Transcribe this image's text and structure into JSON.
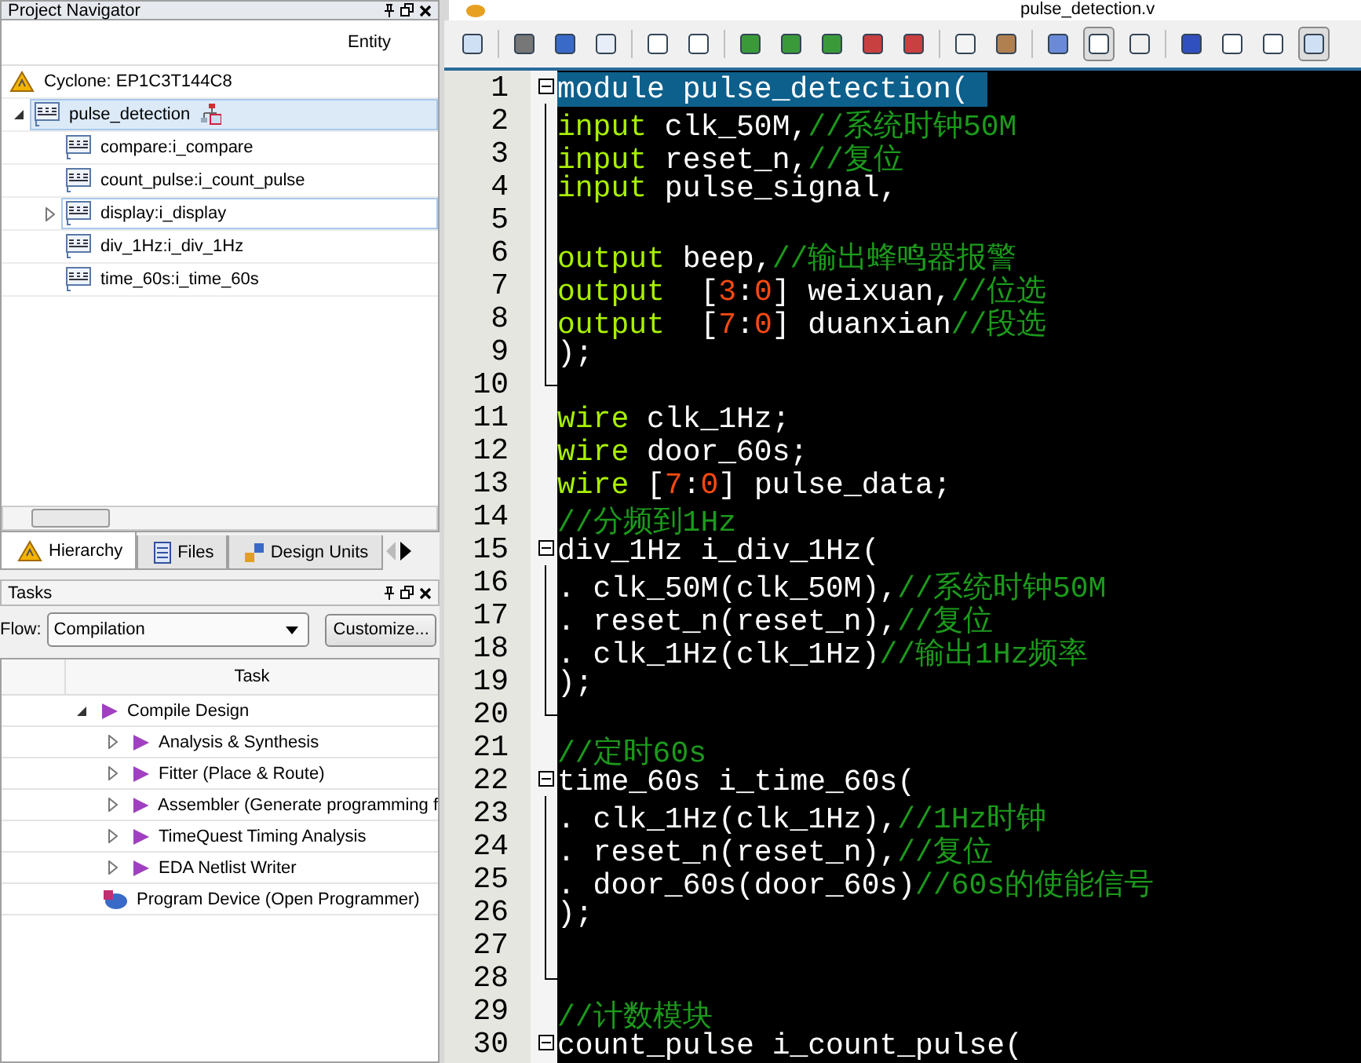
{
  "navigator": {
    "title": "Project Navigator",
    "column": "Entity",
    "device": {
      "label": "Cyclone: EP1C3T144C8"
    },
    "tree": [
      {
        "label": "pulse_detection",
        "selected": true,
        "expanded": true,
        "children": [
          {
            "label": "compare:i_compare",
            "selected": false
          },
          {
            "label": "count_pulse:i_count_pulse",
            "selected": false
          },
          {
            "label": "display:i_display",
            "selected": false,
            "hovered": true,
            "expanded": false
          },
          {
            "label": "div_1Hz:i_div_1Hz",
            "selected": false
          },
          {
            "label": "time_60s:i_time_60s",
            "selected": false
          }
        ]
      }
    ],
    "tabs": [
      {
        "label": "Hierarchy",
        "selected": true
      },
      {
        "label": "Files",
        "selected": false
      },
      {
        "label": "Design Units",
        "selected": false
      }
    ]
  },
  "tasks": {
    "title": "Tasks",
    "flow_label": "Flow:",
    "flow_value": "Compilation",
    "customize": "Customize...",
    "column": "Task",
    "items": [
      {
        "label": "Compile Design",
        "kind": "play",
        "expanded": true,
        "children": [
          {
            "label": "Analysis & Synthesis",
            "kind": "play",
            "expanded": false
          },
          {
            "label": "Fitter (Place & Route)",
            "kind": "play",
            "expanded": false
          },
          {
            "label": "Assembler (Generate programming f",
            "kind": "play",
            "expanded": false
          },
          {
            "label": "TimeQuest Timing Analysis",
            "kind": "play",
            "expanded": false
          },
          {
            "label": "EDA Netlist Writer",
            "kind": "play",
            "expanded": false
          }
        ]
      },
      {
        "label": "Program Device (Open Programmer)",
        "kind": "program"
      }
    ]
  },
  "editor": {
    "file_title": "pulse_detection.v",
    "lines": [
      {
        "no": "1",
        "kind": "fold_start",
        "selected": true,
        "parts": [
          {
            "kind": "plain",
            "text": "module pulse_detection( "
          }
        ]
      },
      {
        "no": "2",
        "kind": "fold_body",
        "parts": [
          {
            "kind": "kw",
            "text": "input"
          },
          {
            "kind": "plain",
            "text": " clk_50M,"
          },
          {
            "kind": "cm",
            "text": "//系统时钟50M"
          }
        ]
      },
      {
        "no": "3",
        "kind": "fold_body",
        "parts": [
          {
            "kind": "kw",
            "text": "input"
          },
          {
            "kind": "plain",
            "text": " reset_n,"
          },
          {
            "kind": "cm",
            "text": "//复位"
          }
        ]
      },
      {
        "no": "4",
        "kind": "fold_body",
        "parts": [
          {
            "kind": "kw",
            "text": "input"
          },
          {
            "kind": "plain",
            "text": " pulse_signal,"
          }
        ]
      },
      {
        "no": "5",
        "kind": "fold_body"
      },
      {
        "no": "6",
        "kind": "fold_body",
        "parts": [
          {
            "kind": "kw",
            "text": "output"
          },
          {
            "kind": "plain",
            "text": " beep,"
          },
          {
            "kind": "cm",
            "text": "//输出蜂鸣器报警"
          }
        ]
      },
      {
        "no": "7",
        "kind": "fold_body",
        "parts": [
          {
            "kind": "kw",
            "text": "output"
          },
          {
            "kind": "plain",
            "text": "  ["
          },
          {
            "kind": "num",
            "text": "3"
          },
          {
            "kind": "plain",
            "text": ":"
          },
          {
            "kind": "num",
            "text": "0"
          },
          {
            "kind": "plain",
            "text": "] weixuan,"
          },
          {
            "kind": "cm",
            "text": "//位选"
          }
        ]
      },
      {
        "no": "8",
        "kind": "fold_body",
        "parts": [
          {
            "kind": "kw",
            "text": "output"
          },
          {
            "kind": "plain",
            "text": "  ["
          },
          {
            "kind": "num",
            "text": "7"
          },
          {
            "kind": "plain",
            "text": ":"
          },
          {
            "kind": "num",
            "text": "0"
          },
          {
            "kind": "plain",
            "text": "] duanxian"
          },
          {
            "kind": "cm",
            "text": "//段选"
          }
        ]
      },
      {
        "no": "9",
        "kind": "fold_body",
        "parts": [
          {
            "kind": "plain",
            "text": ");"
          }
        ]
      },
      {
        "no": "10",
        "kind": "fold_end"
      },
      {
        "no": "11",
        "kind": "plain",
        "parts": [
          {
            "kind": "kw",
            "text": "wire"
          },
          {
            "kind": "plain",
            "text": " clk_1Hz;"
          }
        ]
      },
      {
        "no": "12",
        "kind": "plain",
        "parts": [
          {
            "kind": "kw",
            "text": "wire"
          },
          {
            "kind": "plain",
            "text": " door_60s;"
          }
        ]
      },
      {
        "no": "13",
        "kind": "plain",
        "parts": [
          {
            "kind": "kw",
            "text": "wire"
          },
          {
            "kind": "plain",
            "text": " ["
          },
          {
            "kind": "num",
            "text": "7"
          },
          {
            "kind": "plain",
            "text": ":"
          },
          {
            "kind": "num",
            "text": "0"
          },
          {
            "kind": "plain",
            "text": "] pulse_data;"
          }
        ]
      },
      {
        "no": "14",
        "kind": "plain",
        "parts": [
          {
            "kind": "cm",
            "text": "//分频到1Hz"
          }
        ]
      },
      {
        "no": "15",
        "kind": "fold_start",
        "parts": [
          {
            "kind": "plain",
            "text": "div_1Hz i_div_1Hz("
          }
        ]
      },
      {
        "no": "16",
        "kind": "fold_body",
        "parts": [
          {
            "kind": "plain",
            "text": ". clk_50M(clk_50M),"
          },
          {
            "kind": "cm",
            "text": "//系统时钟50M"
          }
        ]
      },
      {
        "no": "17",
        "kind": "fold_body",
        "parts": [
          {
            "kind": "plain",
            "text": ". reset_n(reset_n),"
          },
          {
            "kind": "cm",
            "text": "//复位"
          }
        ]
      },
      {
        "no": "18",
        "kind": "fold_body",
        "parts": [
          {
            "kind": "plain",
            "text": ". clk_1Hz(clk_1Hz)"
          },
          {
            "kind": "cm",
            "text": "//输出1Hz频率"
          }
        ]
      },
      {
        "no": "19",
        "kind": "fold_body",
        "parts": [
          {
            "kind": "plain",
            "text": ");"
          }
        ]
      },
      {
        "no": "20",
        "kind": "fold_end"
      },
      {
        "no": "21",
        "kind": "plain",
        "parts": [
          {
            "kind": "cm",
            "text": "//定时60s"
          }
        ]
      },
      {
        "no": "22",
        "kind": "fold_start",
        "parts": [
          {
            "kind": "plain",
            "text": "time_60s i_time_60s("
          }
        ]
      },
      {
        "no": "23",
        "kind": "fold_body",
        "parts": [
          {
            "kind": "plain",
            "text": ". clk_1Hz(clk_1Hz),"
          },
          {
            "kind": "cm",
            "text": "//1Hz时钟"
          }
        ]
      },
      {
        "no": "24",
        "kind": "fold_body",
        "parts": [
          {
            "kind": "plain",
            "text": ". reset_n(reset_n),"
          },
          {
            "kind": "cm",
            "text": "//复位"
          }
        ]
      },
      {
        "no": "25",
        "kind": "fold_body",
        "parts": [
          {
            "kind": "plain",
            "text": ". door_60s(door_60s)"
          },
          {
            "kind": "cm",
            "text": "//60s的使能信号"
          }
        ]
      },
      {
        "no": "26",
        "kind": "fold_body",
        "parts": [
          {
            "kind": "plain",
            "text": ");"
          }
        ]
      },
      {
        "no": "27",
        "kind": "fold_body"
      },
      {
        "no": "28",
        "kind": "fold_end"
      },
      {
        "no": "29",
        "kind": "plain",
        "parts": [
          {
            "kind": "cm",
            "text": "//计数模块"
          }
        ]
      },
      {
        "no": "30",
        "kind": "fold_start",
        "parts": [
          {
            "kind": "plain",
            "text": "count_pulse i_count_pulse("
          }
        ]
      }
    ]
  }
}
